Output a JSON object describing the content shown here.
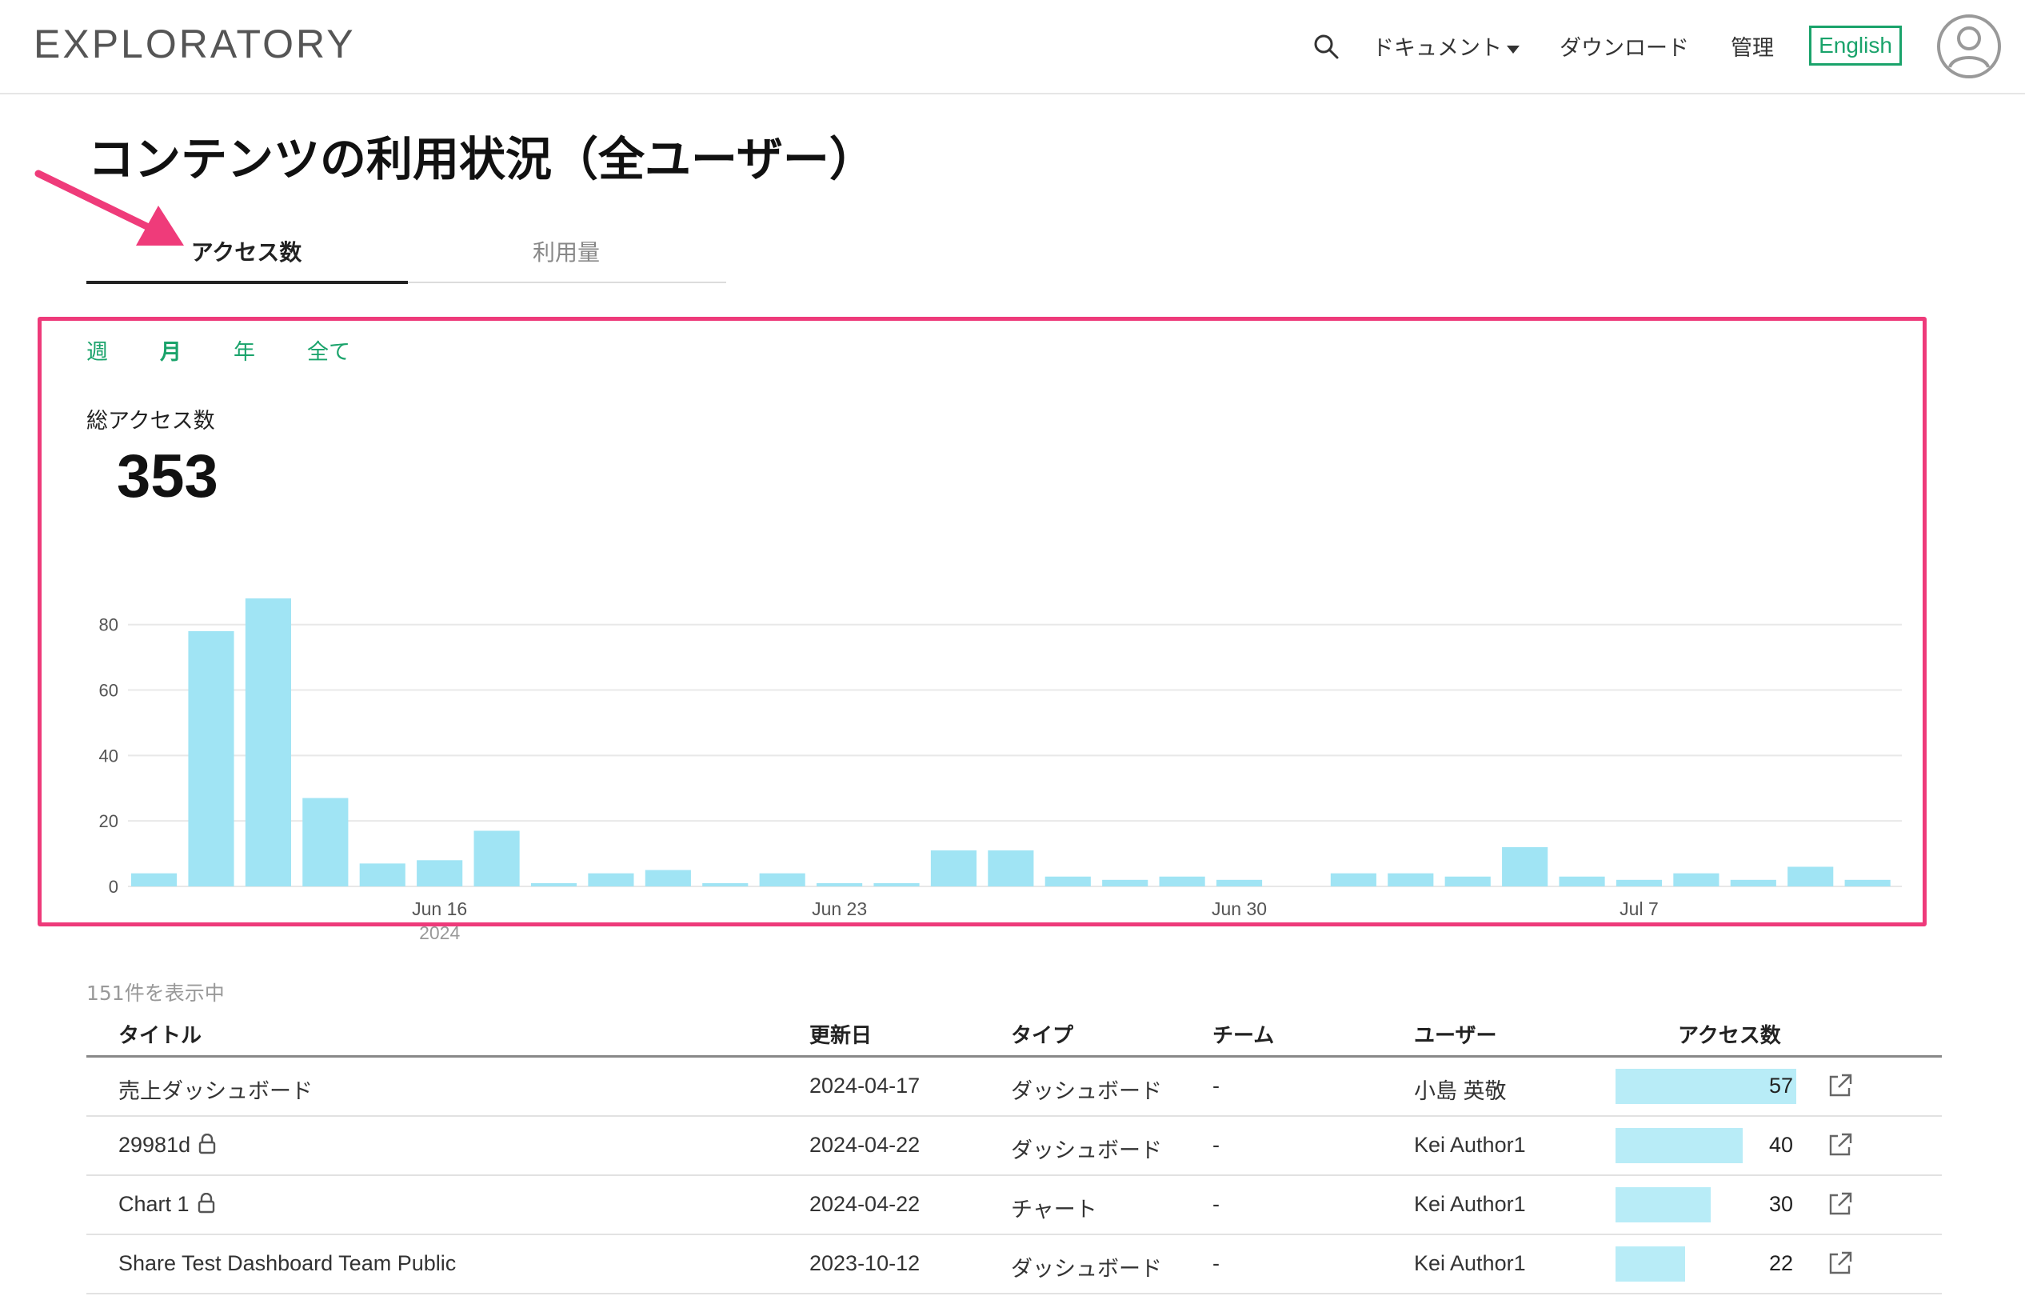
{
  "header": {
    "logo": "EXPLORATORY",
    "nav": {
      "search_icon": "search-icon",
      "documents": "ドキュメント",
      "download": "ダウンロード",
      "admin": "管理",
      "language": "English"
    },
    "accent_color": "#1aa36b"
  },
  "page": {
    "title": "コンテンツの利用状況（全ユーザー）",
    "tabs": [
      {
        "label": "アクセス数",
        "active": true
      },
      {
        "label": "利用量",
        "active": false
      }
    ]
  },
  "period_filters": [
    {
      "label": "週",
      "selected": false
    },
    {
      "label": "月",
      "selected": true
    },
    {
      "label": "年",
      "selected": false
    },
    {
      "label": "全て",
      "selected": false
    }
  ],
  "summary": {
    "label": "総アクセス数",
    "value": "353"
  },
  "chart_data": {
    "type": "bar",
    "bar_color": "#a0e4f4",
    "ylim": [
      0,
      88
    ],
    "y_ticks": [
      0,
      20,
      40,
      60,
      80
    ],
    "x_tick_labels": [
      {
        "label": "Jun 16",
        "sublabel": "2024",
        "index": 5
      },
      {
        "label": "Jun 23",
        "index": 12
      },
      {
        "label": "Jun 30",
        "index": 19
      },
      {
        "label": "Jul 7",
        "index": 26
      }
    ],
    "values": [
      4,
      78,
      88,
      27,
      7,
      8,
      17,
      1,
      4,
      5,
      1,
      4,
      1,
      1,
      11,
      11,
      3,
      2,
      3,
      2,
      0,
      4,
      4,
      3,
      12,
      3,
      2,
      4,
      2,
      6,
      2
    ]
  },
  "table": {
    "count_text": "151件を表示中",
    "headers": {
      "title": "タイトル",
      "updated": "更新日",
      "type": "タイプ",
      "team": "チーム",
      "user": "ユーザー",
      "access": "アクセス数"
    },
    "max_access": 57,
    "rows": [
      {
        "title": "売上ダッシュボード",
        "locked": false,
        "updated": "2024-04-17",
        "type": "ダッシュボード",
        "team": "-",
        "user": "小島 英敬",
        "access": 57
      },
      {
        "title": "29981d",
        "locked": true,
        "updated": "2024-04-22",
        "type": "ダッシュボード",
        "team": "-",
        "user": "Kei Author1",
        "access": 40
      },
      {
        "title": "Chart 1",
        "locked": true,
        "updated": "2024-04-22",
        "type": "チャート",
        "team": "-",
        "user": "Kei Author1",
        "access": 30
      },
      {
        "title": "Share Test Dashboard Team Public",
        "locked": false,
        "updated": "2023-10-12",
        "type": "ダッシュボード",
        "team": "-",
        "user": "Kei Author1",
        "access": 22
      }
    ]
  }
}
